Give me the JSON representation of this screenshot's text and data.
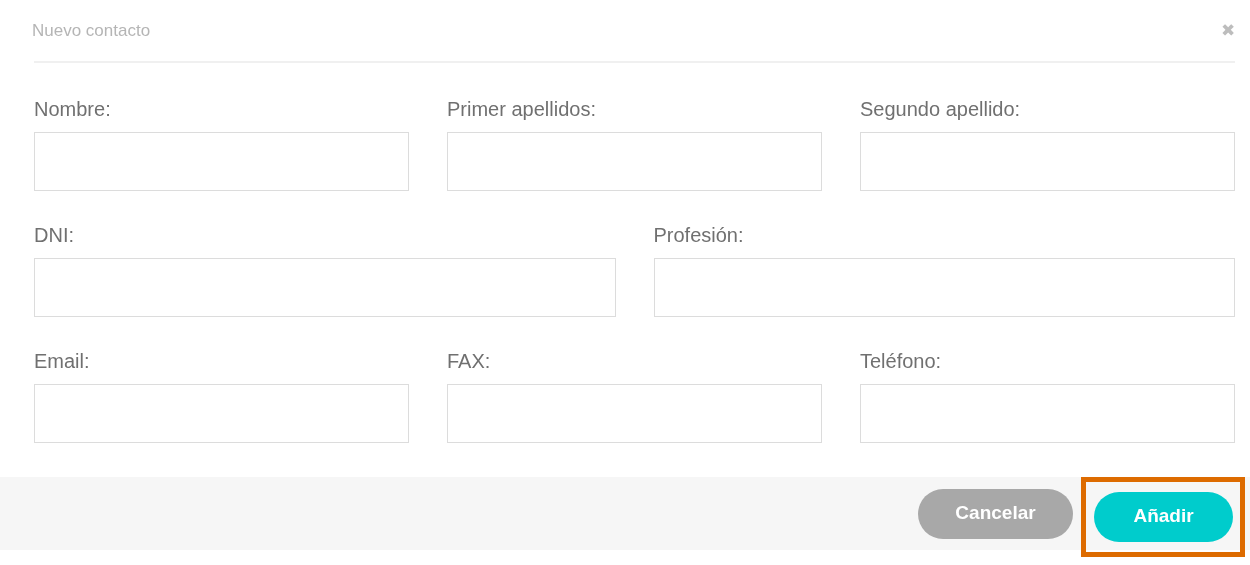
{
  "dialog": {
    "title": "Nuevo contacto",
    "close": "✖"
  },
  "rows": [
    {
      "fields": [
        {
          "label": "Nombre:"
        },
        {
          "label": "Primer apellidos:"
        },
        {
          "label": "Segundo apellido:"
        }
      ]
    },
    {
      "fields": [
        {
          "label": "DNI:"
        },
        {
          "label": "Profesión:"
        }
      ]
    },
    {
      "fields": [
        {
          "label": "Email:"
        },
        {
          "label": "FAX:"
        },
        {
          "label": "Teléfono:"
        }
      ]
    }
  ],
  "buttons": [
    {
      "label": "Cancelar",
      "kind": "secondary",
      "highlighted": false
    },
    {
      "label": "Añadir",
      "kind": "primary",
      "highlighted": true
    }
  ]
}
